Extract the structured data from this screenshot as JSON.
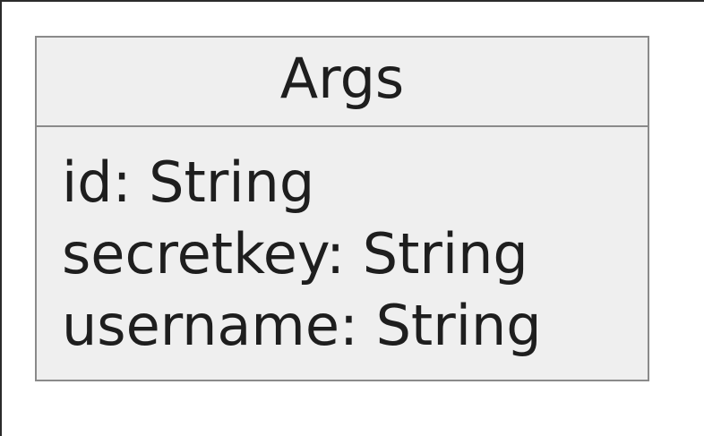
{
  "diagram": {
    "type": "uml-class",
    "class": {
      "name": "Args",
      "attributes": [
        "id: String",
        "secretkey: String",
        "username: String"
      ]
    },
    "colors": {
      "box_fill": "#efefef",
      "box_border": "#8a8a8a",
      "text": "#1e1e1e"
    }
  }
}
